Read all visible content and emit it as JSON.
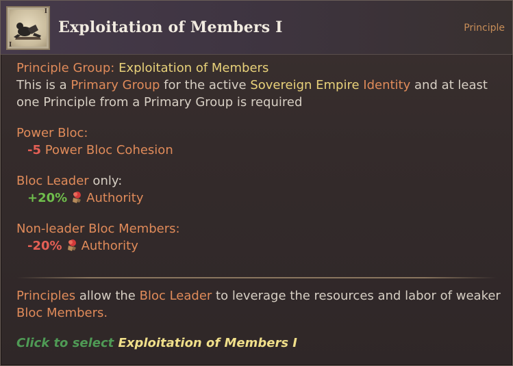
{
  "header": {
    "title": "Exploitation of Members I",
    "type_label": "Principle",
    "icon_name": "principle-icon",
    "icon_corner_tr": "I",
    "icon_corner_bl": "I"
  },
  "group": {
    "label": "Principle Group:",
    "value": "Exploitation of Members",
    "desc_1": "This is a ",
    "primary_group": "Primary Group",
    "desc_2": " for the active ",
    "sovereign_empire": "Sovereign Empire",
    "identity": "Identity",
    "desc_3": " and at least",
    "desc_line2": "one Principle from a Primary Group is required"
  },
  "power_bloc": {
    "heading": "Power Bloc:",
    "value": "-5",
    "effect": "Power Bloc Cohesion"
  },
  "bloc_leader": {
    "heading": "Bloc Leader",
    "suffix": " only:",
    "value": "+20%",
    "effect": "Authority"
  },
  "non_leader": {
    "heading": "Non-leader Bloc Members:",
    "value": "-20%",
    "effect": "Authority"
  },
  "footer": {
    "principles": "Principles",
    "mid": " allow the ",
    "bloc_leader": "Bloc Leader",
    "rest": " to leverage the resources and labor of weaker",
    "bloc_members": "Bloc Members."
  },
  "cta": {
    "prefix": "Click to select ",
    "target": "Exploitation of Members I"
  },
  "colors": {
    "orange": "#e08b5a",
    "yellow": "#e9d27a",
    "red": "#e45f55",
    "green": "#6fbe4c"
  }
}
